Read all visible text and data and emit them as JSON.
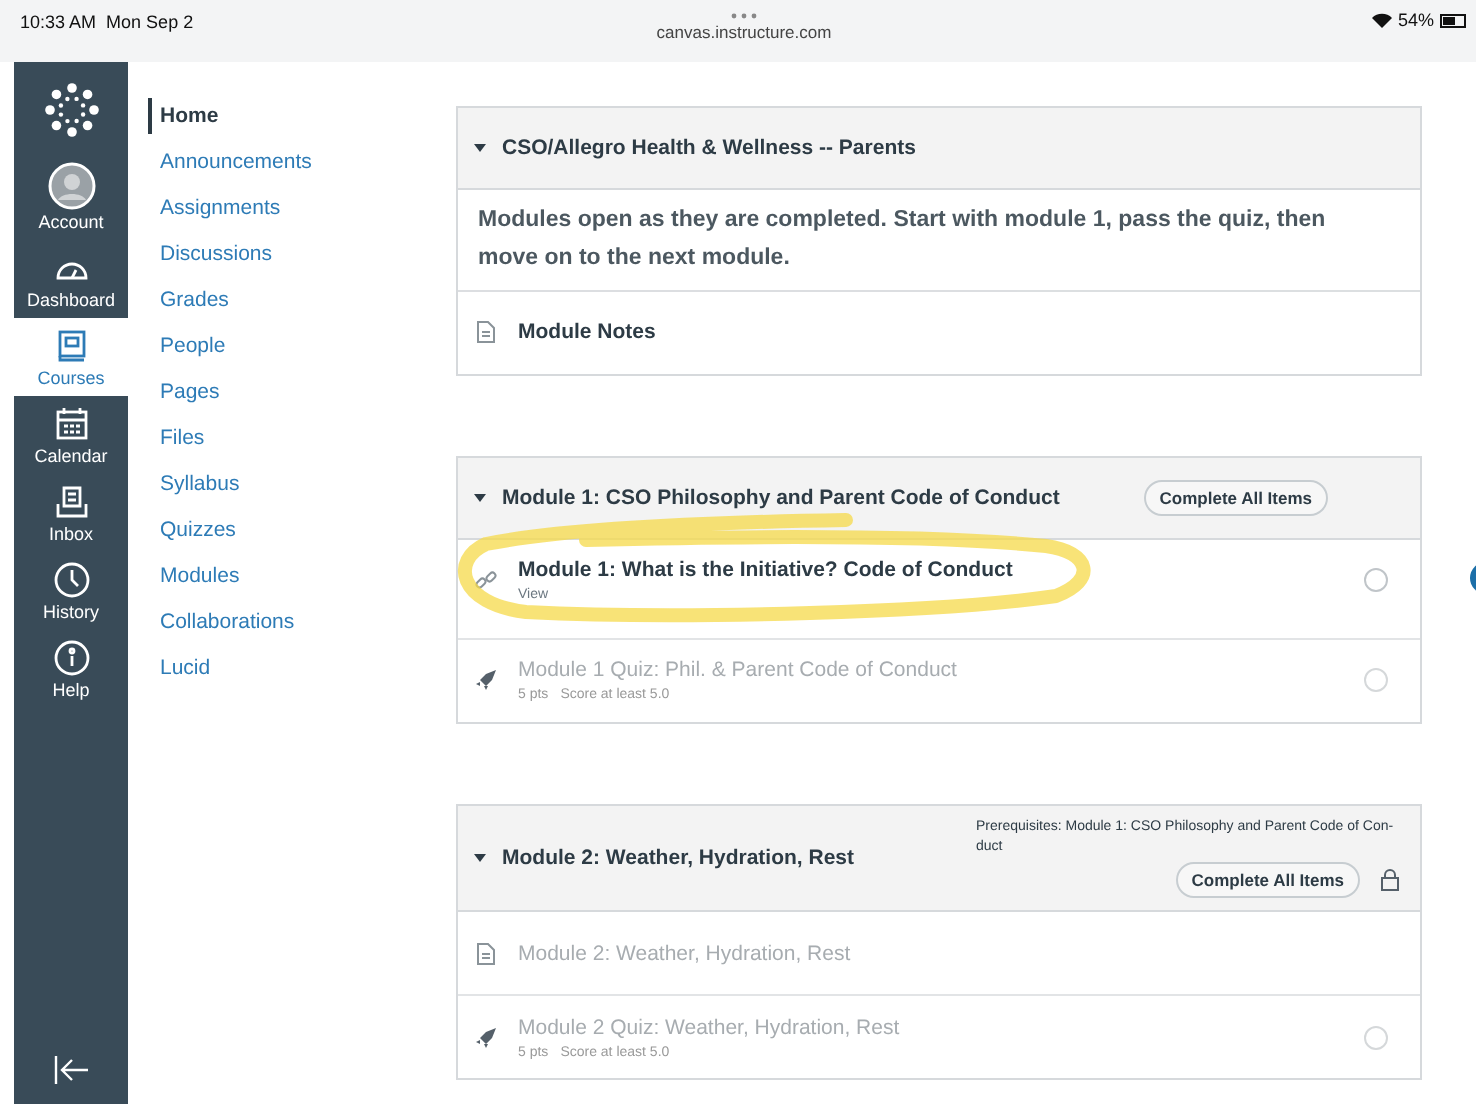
{
  "status_bar": {
    "time": "10:33 AM",
    "date": "Mon Sep 2",
    "url": "canvas.instructure.com",
    "battery": "54%"
  },
  "global_nav": [
    {
      "kind": "logo",
      "selected": false
    },
    {
      "kind": "account",
      "label": "Account",
      "selected": false
    },
    {
      "kind": "dashboard",
      "label": "Dashboard",
      "selected": false
    },
    {
      "kind": "courses",
      "label": "Courses",
      "selected": true
    },
    {
      "kind": "calendar",
      "label": "Calendar",
      "selected": false
    },
    {
      "kind": "inbox",
      "label": "Inbox",
      "selected": false
    },
    {
      "kind": "history",
      "label": "History",
      "selected": false
    },
    {
      "kind": "help",
      "label": "Help",
      "selected": false
    }
  ],
  "course_nav": [
    {
      "label": "Home",
      "selected": true
    },
    {
      "label": "Announcements",
      "selected": false
    },
    {
      "label": "Assignments",
      "selected": false
    },
    {
      "label": "Discussions",
      "selected": false
    },
    {
      "label": "Grades",
      "selected": false
    },
    {
      "label": "People",
      "selected": false
    },
    {
      "label": "Pages",
      "selected": false
    },
    {
      "label": "Files",
      "selected": false
    },
    {
      "label": "Syllabus",
      "selected": false
    },
    {
      "label": "Quizzes",
      "selected": false
    },
    {
      "label": "Modules",
      "selected": false
    },
    {
      "label": "Collaborations",
      "selected": false
    },
    {
      "label": "Lucid",
      "selected": false
    }
  ],
  "modules": [
    {
      "title": "CSO/Allegro Health & Wellness -- Parents",
      "description": "Modules open as they are completed. Start with module 1, pass the quiz, then move on to the next module.",
      "items": [
        {
          "kind": "page",
          "title": "Module Notes",
          "disabled": false,
          "circle": false
        }
      ]
    },
    {
      "title": "Module 1: CSO Philosophy and Parent Code of Conduct",
      "requirement": "Complete All Items",
      "locked": false,
      "items": [
        {
          "kind": "link",
          "title": "Module 1: What is the Initiative? Code of Conduct",
          "meta": [
            "View"
          ],
          "disabled": false,
          "circle": true,
          "highlighted": true
        },
        {
          "kind": "quiz",
          "title": "Module 1 Quiz: Phil. & Parent Code of Conduct",
          "meta": [
            "5 pts",
            "Score at least 5.0"
          ],
          "disabled": true,
          "circle": true
        }
      ]
    },
    {
      "title": "Module 2: Weather, Hydration, Rest",
      "prerequisites": "Prerequisites: Module 1: CSO Philosophy and Parent Code of Con- duct",
      "requirement": "Complete All Items",
      "locked": true,
      "items": [
        {
          "kind": "page",
          "title": "Module 2: Weather, Hydration, Rest",
          "disabled": true,
          "circle": false
        },
        {
          "kind": "quiz",
          "title": "Module 2 Quiz: Weather, Hydration, Rest",
          "meta": [
            "5 pts",
            "Score at least 5.0"
          ],
          "disabled": true,
          "circle": true
        }
      ]
    }
  ]
}
